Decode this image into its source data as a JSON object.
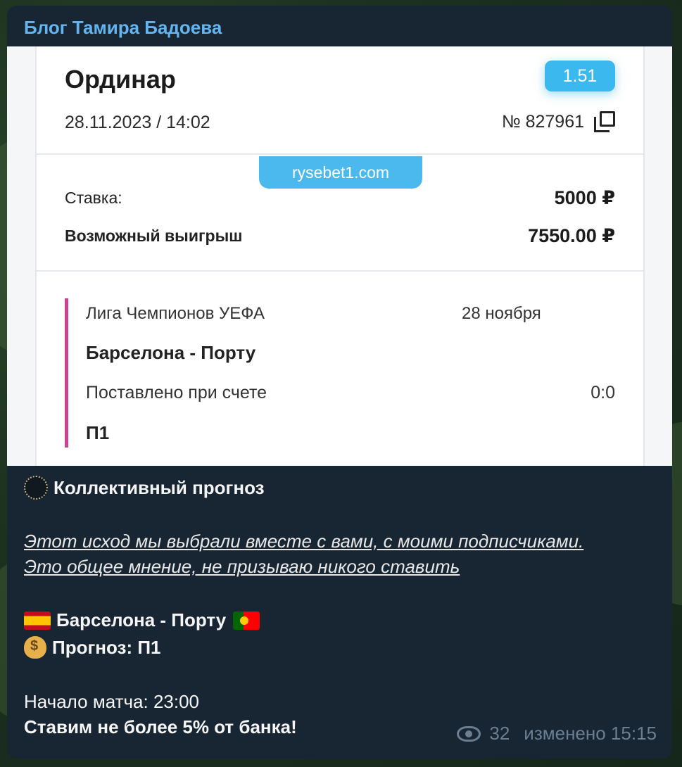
{
  "channel": {
    "name": "Блог Тамира Бадоева"
  },
  "bet_slip": {
    "title": "Ординар",
    "coefficient": "1.51",
    "datetime": "28.11.2023 / 14:02",
    "number": "№ 827961",
    "site": "rysebet1.com",
    "stake_label": "Ставка:",
    "stake_value": "5000 ₽",
    "win_label": "Возможный выигрыш",
    "win_value": "7550.00 ₽",
    "event": {
      "league": "Лига Чемпионов УЕФА",
      "date": "28 ноября",
      "match": "Барселона - Порту",
      "placed_label": "Поставлено при счете",
      "score": "0:0",
      "outcome": "П1"
    }
  },
  "post": {
    "heading": "Коллективный прогноз",
    "disclaimer_line1": "Этот исход мы выбрали вместе с вами, с моими подписчиками.",
    "disclaimer_line2": "Это общее мнение, не призываю никого ставить",
    "match_line": "Барселона - Порту",
    "forecast": "Прогноз: П1",
    "start": "Начало матча: 23:00",
    "advice": "Ставим не более 5% от банка!"
  },
  "meta": {
    "views": "32",
    "edited": "изменено 15:15"
  },
  "icons": [
    "moon-icon",
    "spain-flag-icon",
    "portugal-flag-icon",
    "money-bag-icon",
    "eye-icon",
    "copy-icon"
  ]
}
